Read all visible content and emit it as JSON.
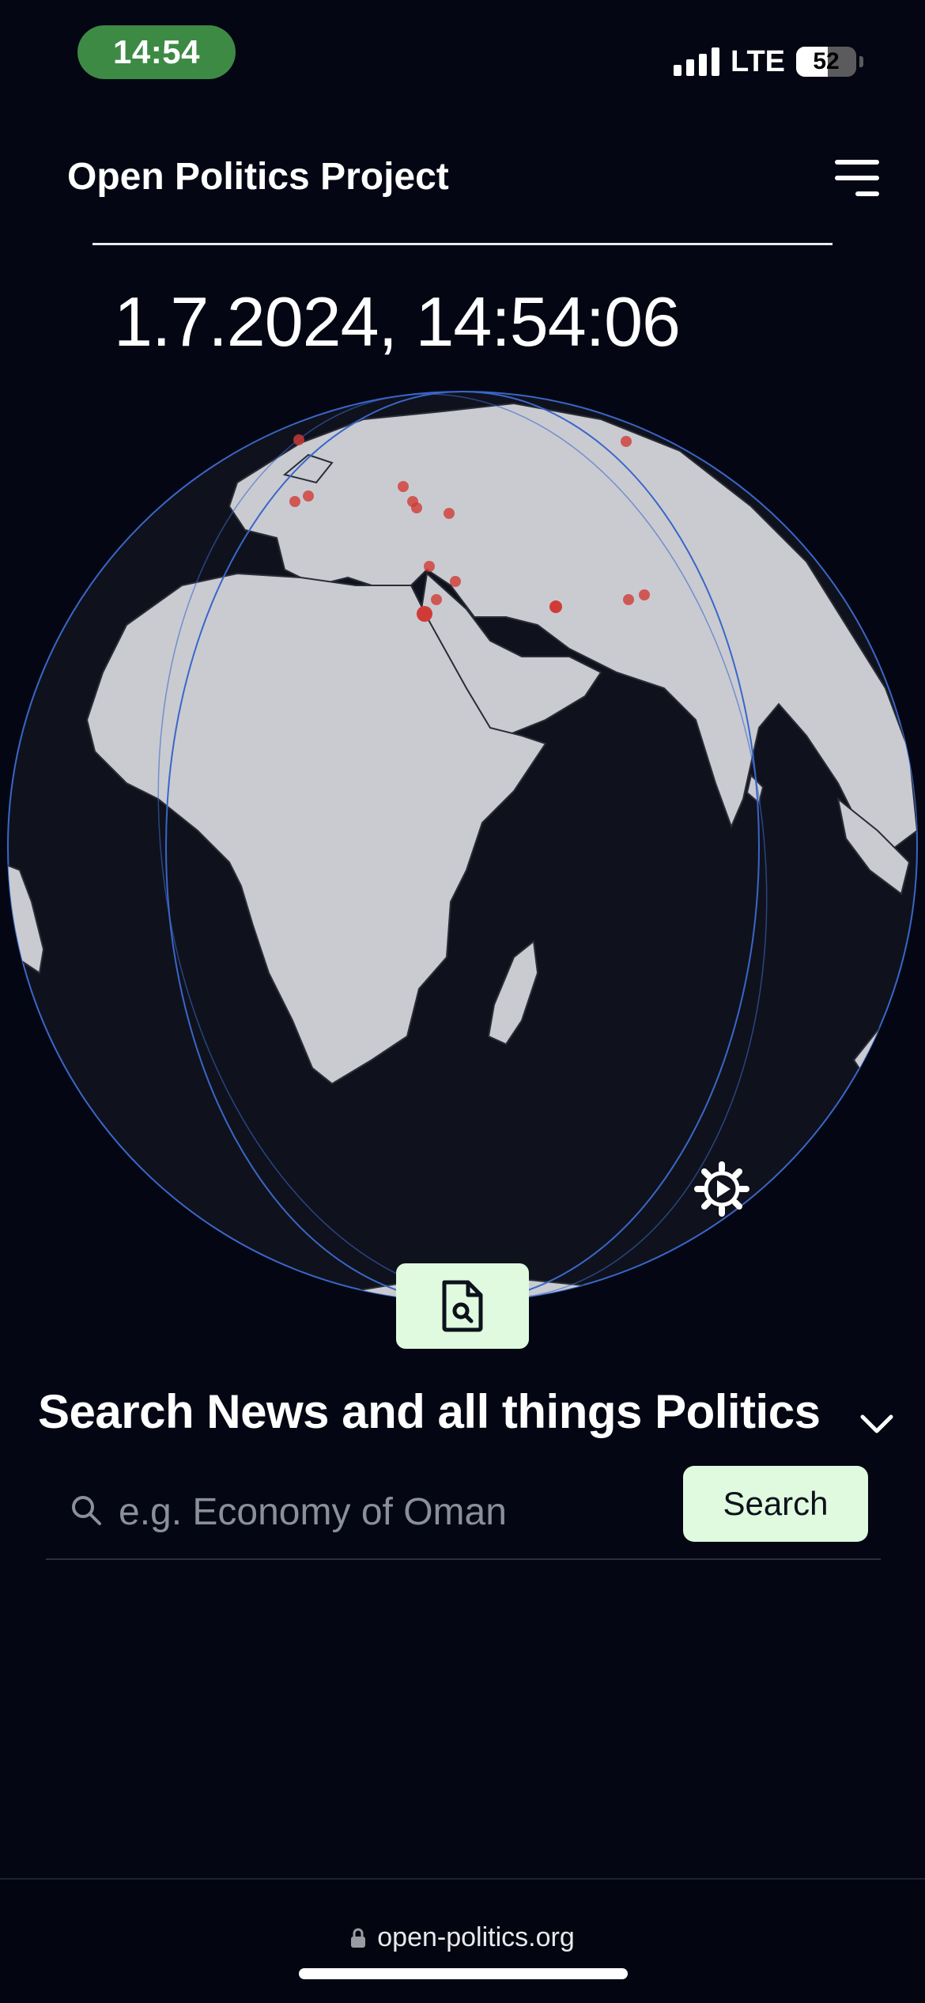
{
  "status_bar": {
    "time": "14:54",
    "network": "LTE",
    "battery_level": "52",
    "signal_bars": 4
  },
  "header": {
    "title": "Open Politics Project",
    "menu_icon": "hamburger-menu-icon"
  },
  "clock": {
    "datetime": "1.7.2024, 14:54:06"
  },
  "globe": {
    "region": "Europe, Africa, Middle East, Asia",
    "land_color": "#c9cbd1",
    "ocean_color": "#0f121c",
    "outline_color": "#3a66c9",
    "event_dot_color": "#d13b36",
    "settings_icon": "gear-icon"
  },
  "doc_button": {
    "icon": "document-search-icon"
  },
  "search": {
    "title": "Search News and all things Politics",
    "placeholder": "e.g. Economy of Oman",
    "value": "",
    "button_label": "Search",
    "toggle_icon": "chevron-down-icon",
    "accent": "#dffadf"
  },
  "browser": {
    "url": "open-politics.org",
    "lock_icon": "lock-icon"
  }
}
